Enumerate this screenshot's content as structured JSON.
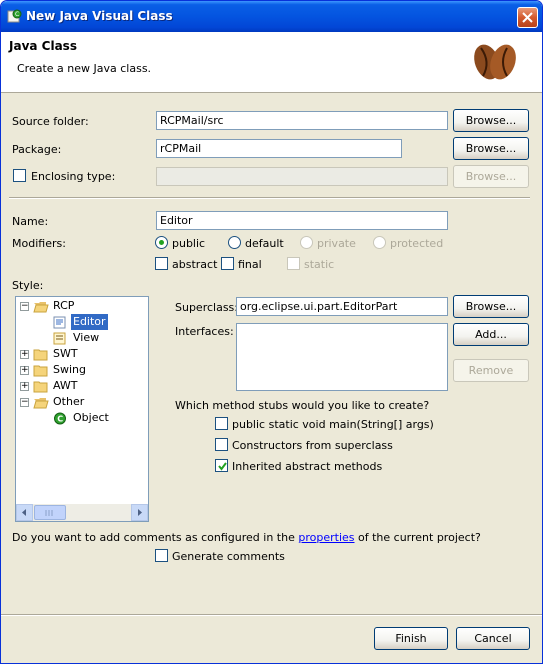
{
  "window": {
    "title": "New Java Visual Class"
  },
  "banner": {
    "title": "Java Class",
    "description": "Create a new Java class."
  },
  "source_folder": {
    "label": "Source folder:",
    "value": "RCPMail/src",
    "browse": "Browse..."
  },
  "package": {
    "label": "Package:",
    "value": "rCPMail",
    "browse": "Browse..."
  },
  "enclosing_type": {
    "label": "Enclosing type:",
    "value": "",
    "browse": "Browse...",
    "checked": false
  },
  "name": {
    "label": "Name:",
    "value": "Editor"
  },
  "modifiers": {
    "label": "Modifiers:",
    "radios": [
      "public",
      "default",
      "private",
      "protected"
    ],
    "selected": "public",
    "checks": [
      "abstract",
      "final",
      "static"
    ]
  },
  "style": {
    "label": "Style:",
    "tree": [
      {
        "label": "RCP",
        "expanded": true
      },
      {
        "label": "Editor",
        "selected": true
      },
      {
        "label": "View"
      },
      {
        "label": "SWT",
        "expanded": false
      },
      {
        "label": "Swing",
        "expanded": false
      },
      {
        "label": "AWT",
        "expanded": false
      },
      {
        "label": "Other",
        "expanded": true
      },
      {
        "label": "Object"
      }
    ]
  },
  "superclass": {
    "label": "Superclass:",
    "value": "org.eclipse.ui.part.EditorPart",
    "browse": "Browse..."
  },
  "interfaces": {
    "label": "Interfaces:",
    "add": "Add...",
    "remove": "Remove"
  },
  "method_stubs": {
    "question": "Which method stubs would you like to create?",
    "options": [
      {
        "label": "public static void main(String[] args)",
        "checked": false
      },
      {
        "label": "Constructors from superclass",
        "checked": false
      },
      {
        "label": "Inherited abstract methods",
        "checked": true
      }
    ]
  },
  "comments": {
    "question_before": "Do you want to add comments as configured in the ",
    "link": "properties",
    "question_after": " of the current project?",
    "generate_label": "Generate comments",
    "checked": false
  },
  "footer": {
    "finish": "Finish",
    "cancel": "Cancel"
  },
  "colors": {
    "title_bar": "#0454e0",
    "selection": "#316ac5",
    "link": "#0000ff"
  }
}
